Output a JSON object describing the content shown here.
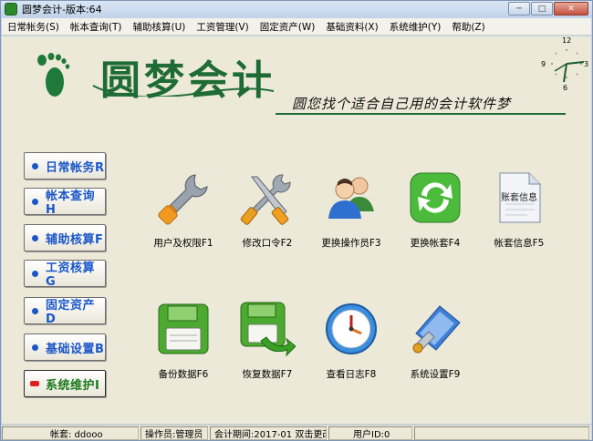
{
  "window": {
    "title": "圆梦会计-版本:64"
  },
  "menu": [
    "日常帐务(S)",
    "帐本查询(T)",
    "辅助核算(U)",
    "工资管理(V)",
    "固定资产(W)",
    "基础资料(X)",
    "系统维护(Y)",
    "帮助(Z)"
  ],
  "logo": {
    "name": "圆梦会计",
    "slogan": "圆您找个适合自己用的会计软件梦"
  },
  "clock": {
    "n12": "12",
    "n3": "3",
    "n6": "6",
    "n9": "9"
  },
  "nav": [
    {
      "label": "日常帐务R"
    },
    {
      "label": "帐本查询H"
    },
    {
      "label": "辅助核算F"
    },
    {
      "label": "工资核算G"
    },
    {
      "label": "固定资产D"
    },
    {
      "label": "基础设置B"
    },
    {
      "label": "系统维护I"
    }
  ],
  "functions": [
    {
      "label": "用户及权限F1",
      "icon": "wrench-icon"
    },
    {
      "label": "修改口令F2",
      "icon": "tools-icon"
    },
    {
      "label": "更换操作员F3",
      "icon": "users-icon"
    },
    {
      "label": "更换帐套F4",
      "icon": "refresh-icon"
    },
    {
      "label": "帐套信息F5",
      "icon": "document-icon",
      "doc_text": "账套信息"
    },
    {
      "label": "备份数据F6",
      "icon": "floppy-icon"
    },
    {
      "label": "恢复数据F7",
      "icon": "floppy-restore-icon"
    },
    {
      "label": "查看日志F8",
      "icon": "clock-icon"
    },
    {
      "label": "系统设置F9",
      "icon": "settings-icon"
    }
  ],
  "status": {
    "account": "帐套: ddooo",
    "operator": "操作员:管理员",
    "period": "会计期间:2017-01 双击更改",
    "user_id": "用户ID:0"
  },
  "colors": {
    "brand_green": "#1f6b35",
    "nav_blue": "#1b57c9",
    "nav_active_green": "#1a7a1a"
  }
}
